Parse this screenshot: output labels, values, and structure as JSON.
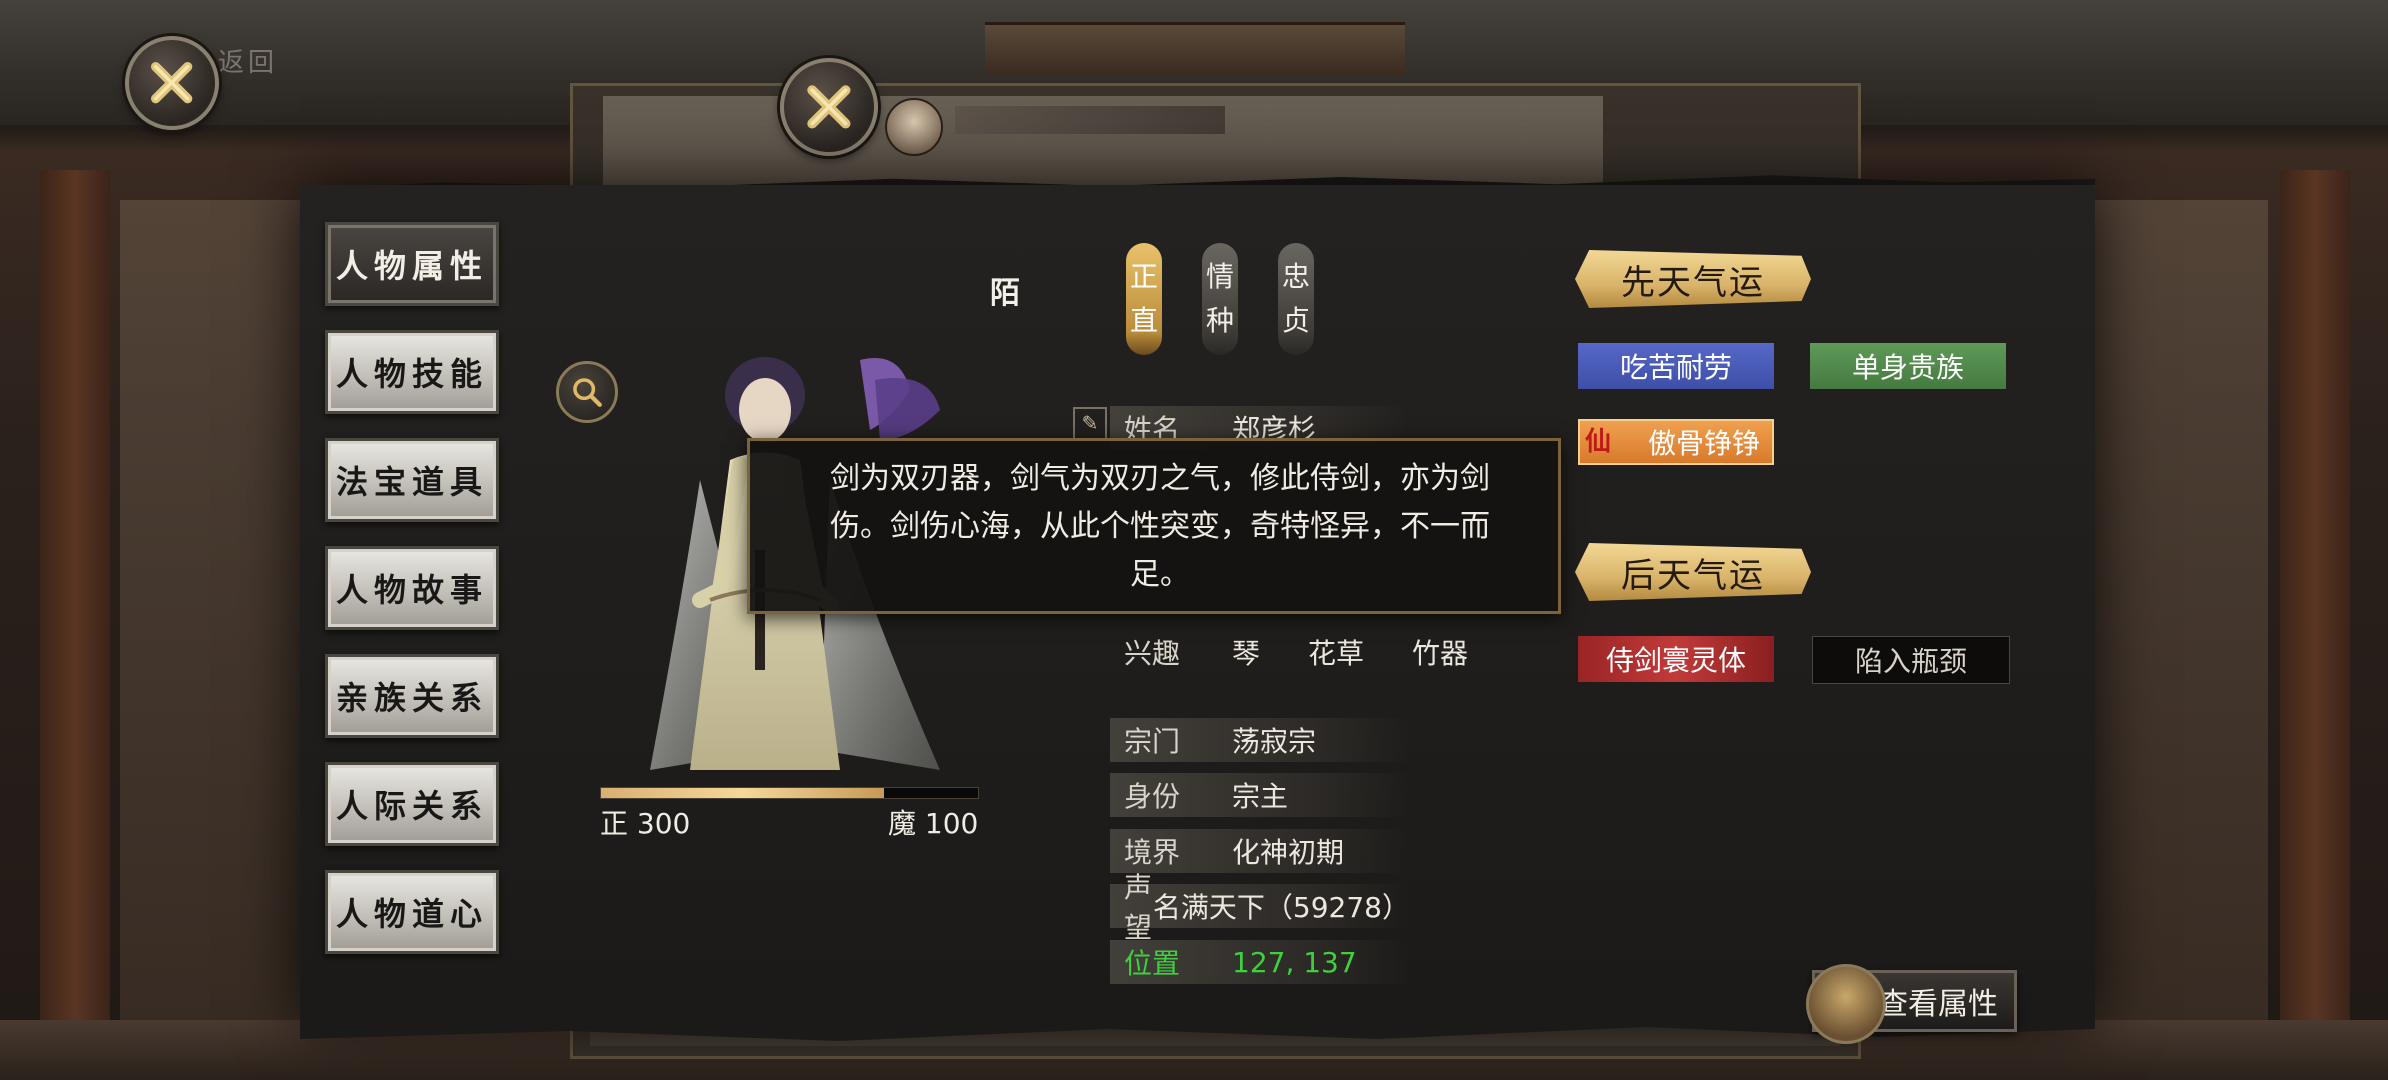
{
  "top": {
    "return_label": "返回"
  },
  "tabs": [
    {
      "label": "人物属性",
      "active": true
    },
    {
      "label": "人物技能"
    },
    {
      "label": "法宝道具"
    },
    {
      "label": "人物故事"
    },
    {
      "label": "亲族关系"
    },
    {
      "label": "人际关系"
    },
    {
      "label": "人物道心"
    }
  ],
  "character": {
    "name_glyph": "陌",
    "traits": [
      {
        "chars": [
          "正",
          "直"
        ],
        "style": "gold"
      },
      {
        "chars": [
          "情",
          "种"
        ],
        "style": "grey"
      },
      {
        "chars": [
          "忠",
          "贞"
        ],
        "style": "grey"
      }
    ],
    "alignment": {
      "left_label": "正 300",
      "right_label": "魔 100",
      "fill_fraction": 0.75
    }
  },
  "info": {
    "name_key": "姓名",
    "name_value": "郑彦杉",
    "hobby_key": "兴趣",
    "hobbies": [
      "琴",
      "花草",
      "竹器"
    ],
    "sect_key": "宗门",
    "sect_value": "荡寂宗",
    "identity_key": "身份",
    "identity_value": "宗主",
    "realm_key": "境界",
    "realm_value": "化神初期",
    "reputation_key": "声望",
    "reputation_value": "名满天下（59278）",
    "location_key": "位置",
    "location_value": "127, 137"
  },
  "tooltip": {
    "text": "剑为双刃器，剑气为双刃之气，修此侍剑，亦为剑伤。剑伤心海，从此个性突变，奇特怪异，不一而足。"
  },
  "innate_fortune": {
    "title": "先天气运",
    "items": [
      {
        "label": "吃苦耐劳",
        "color": "#4a5cc0"
      },
      {
        "label": "单身贵族",
        "color": "#538c4c"
      },
      {
        "label": "傲骨铮铮",
        "color": "#e88c3c",
        "badge": "仙"
      }
    ]
  },
  "acquired_fortune": {
    "title": "后天气运",
    "items": [
      {
        "label": "侍剑寰灵体",
        "color": "#b02e2e"
      },
      {
        "label": "陷入瓶颈",
        "color": "#0d0c0b"
      }
    ]
  },
  "view_button": {
    "label": "查看属性"
  },
  "colors": {
    "gold": "#e0b868",
    "green_value": "#3fcf3f",
    "panel": "#1f1d1b"
  }
}
